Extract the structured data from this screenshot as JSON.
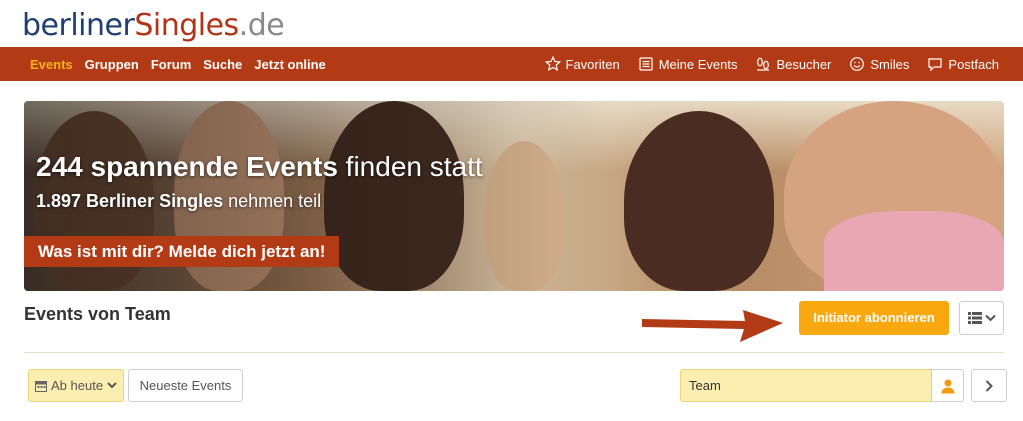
{
  "logo": {
    "part1": "berliner",
    "part2": "Singles",
    "part3": ".de"
  },
  "nav": {
    "left": [
      "Events",
      "Gruppen",
      "Forum",
      "Suche",
      "Jetzt online"
    ],
    "right": [
      {
        "label": "Favoriten",
        "icon": "star-icon"
      },
      {
        "label": "Meine Events",
        "icon": "list-icon"
      },
      {
        "label": "Besucher",
        "icon": "footprints-icon"
      },
      {
        "label": "Smiles",
        "icon": "smile-icon"
      },
      {
        "label": "Postfach",
        "icon": "message-icon"
      }
    ]
  },
  "hero": {
    "title_bold": "244 spannende Events",
    "title_rest": " finden statt",
    "sub_bold": "1.897 Berliner Singles",
    "sub_rest": " nehmen teil",
    "cta": "Was ist mit dir? Melde dich jetzt an!"
  },
  "section": {
    "title": "Events von Team",
    "subscribe_label": "Initiator abonnieren"
  },
  "filters": {
    "date_label": "Ab heute",
    "newest_label": "Neueste Events",
    "search_value": "Team"
  },
  "colors": {
    "brand_red": "#b23a14",
    "active_nav": "#f9b21a",
    "subscribe": "#f9a80f",
    "logo_blue": "#1f3e73"
  }
}
